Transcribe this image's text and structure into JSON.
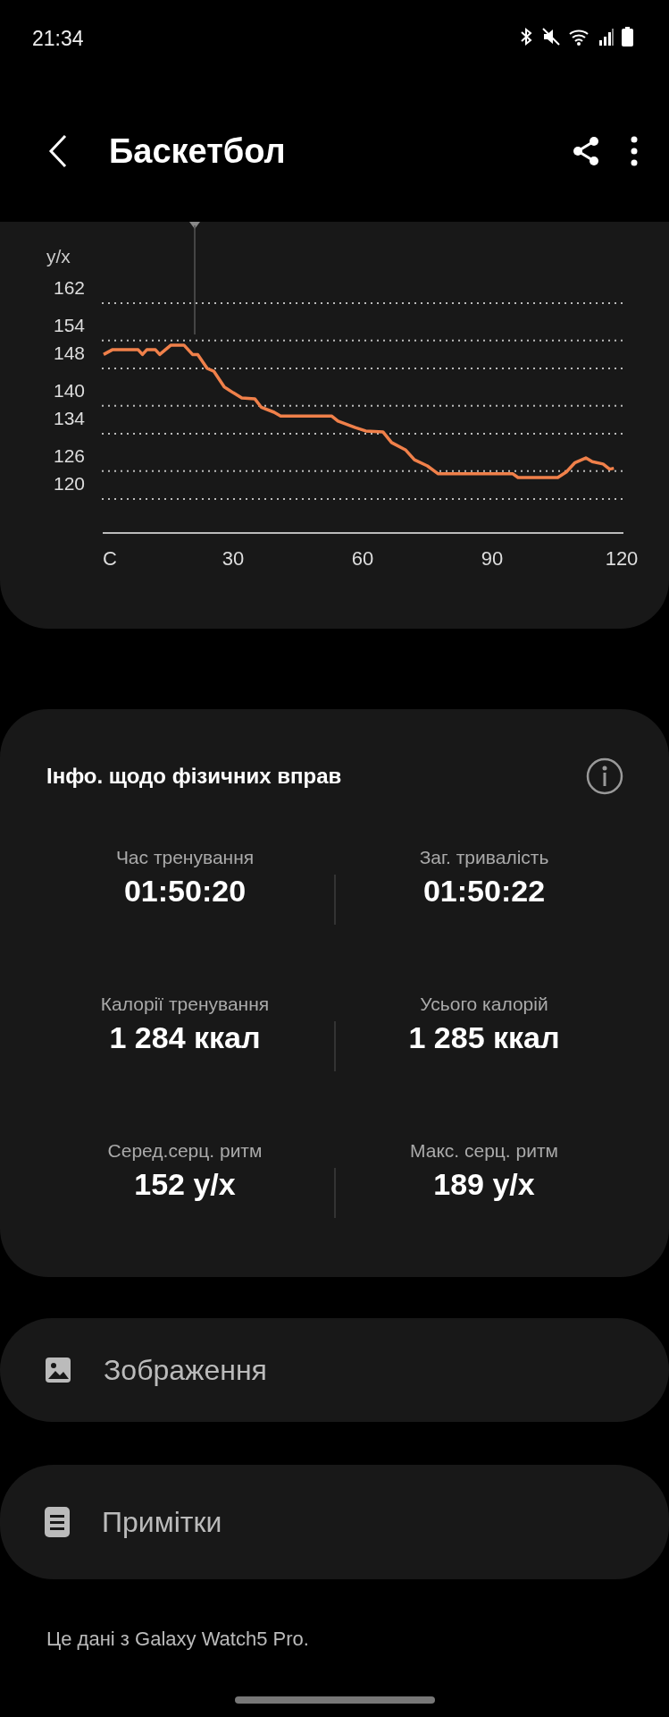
{
  "status_bar": {
    "time": "21:34"
  },
  "header": {
    "title": "Баскетбол"
  },
  "heart_rate_chart": {
    "unit_label": "y/x",
    "chart_data": {
      "type": "line",
      "x": [
        0,
        2,
        8,
        9,
        10,
        12,
        13,
        15.6,
        18.6,
        20.6,
        21.8,
        24,
        25.5,
        28,
        30,
        32,
        35,
        36.5,
        39.5,
        41,
        52.8,
        54.3,
        58.3,
        60.7,
        64.7,
        66.7,
        70,
        72,
        75,
        77.5,
        94.8,
        96,
        105.2,
        107.2,
        109.2,
        111.7,
        113.2,
        115.7,
        117.2,
        118.2
      ],
      "series": [
        {
          "color": "#f0804a",
          "values": [
            151,
            152,
            152,
            151,
            152,
            152,
            151,
            153,
            153,
            151,
            151,
            148,
            147.4,
            144,
            142.8,
            141.7,
            141.5,
            139.7,
            138.6,
            137.8,
            137.8,
            136.7,
            135.3,
            134.6,
            134.4,
            132.1,
            130.5,
            128.4,
            127.1,
            125.4,
            125.4,
            124.6,
            124.6,
            125.8,
            127.8,
            128.8,
            128,
            127.5,
            126.4,
            126.6
          ]
        }
      ],
      "xlim": [
        0,
        120
      ],
      "ylim": [
        120,
        162
      ],
      "grid": true,
      "xticks": [
        {
          "value": 0,
          "label": "С"
        },
        30,
        60,
        90,
        120
      ],
      "yticks": [
        162,
        154,
        148,
        140,
        134,
        126,
        120
      ]
    }
  },
  "exercise_info": {
    "title": "Інфо. щодо фізичних вправ",
    "stats": [
      {
        "label": "Час тренування",
        "value": "01:50:20"
      },
      {
        "label": "Заг. тривалість",
        "value": "01:50:22"
      },
      {
        "label": "Калорії тренування",
        "value": "1 284 ккал"
      },
      {
        "label": "Усього калорій",
        "value": "1 285 ккал"
      },
      {
        "label": "Серед.серц. ритм",
        "value": "152 y/x"
      },
      {
        "label": "Макс. серц. ритм",
        "value": "189 y/x"
      }
    ]
  },
  "links": [
    {
      "kind": "images",
      "label": "Зображення"
    },
    {
      "kind": "notes",
      "label": "Примітки"
    }
  ],
  "footer": "Це дані з Galaxy Watch5 Pro."
}
